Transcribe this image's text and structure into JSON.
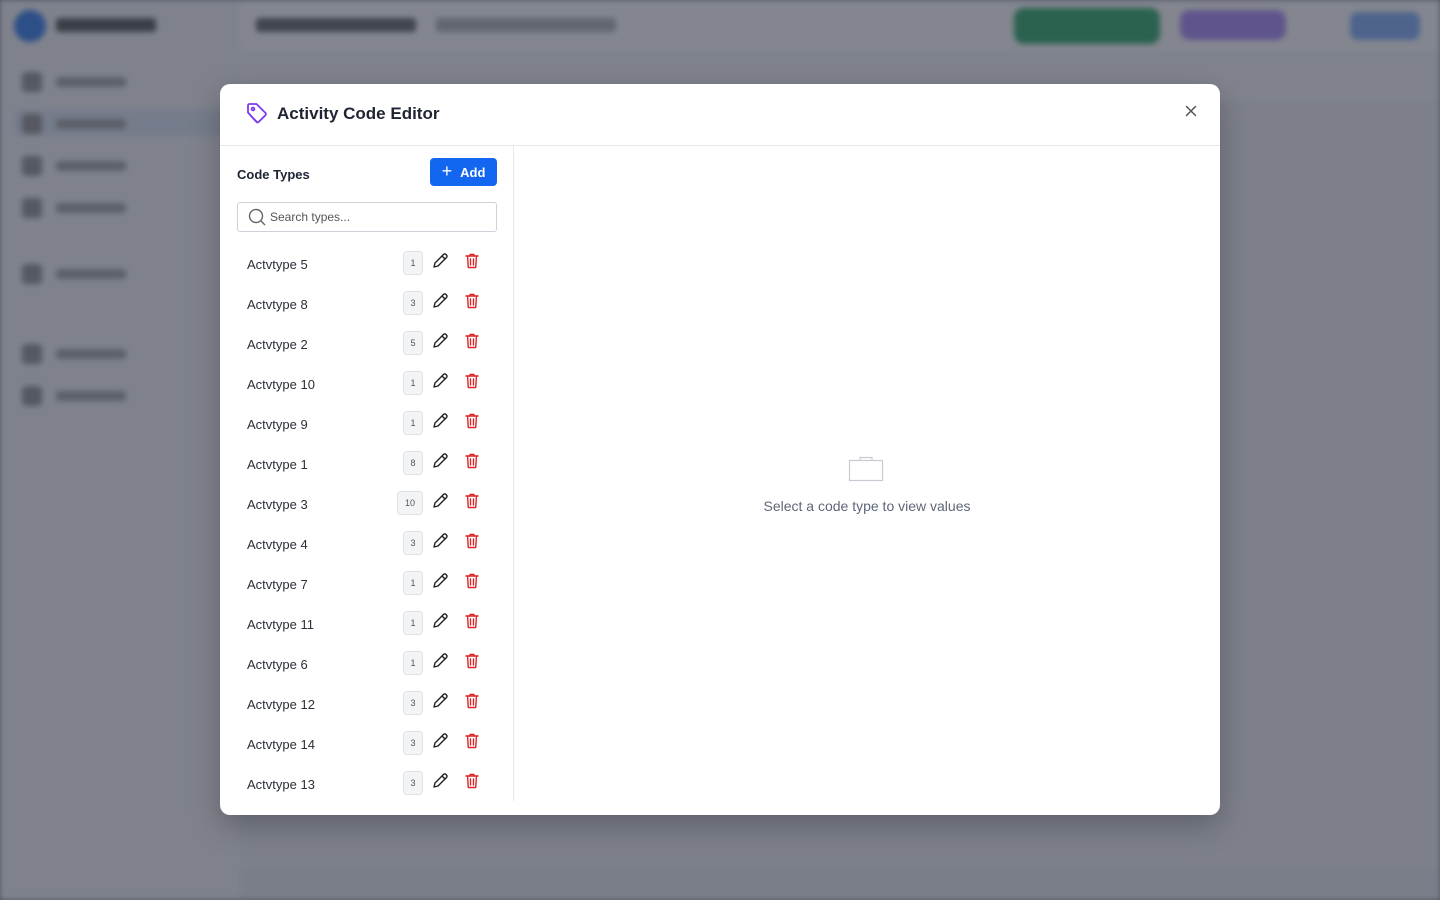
{
  "modal": {
    "title": "Activity Code Editor",
    "close_label": "×"
  },
  "left_pane": {
    "title": "Code Types",
    "add_label": "Add",
    "search_placeholder": "Search types...",
    "types": [
      {
        "name": "Actvtype 5",
        "count": "1"
      },
      {
        "name": "Actvtype 8",
        "count": "3"
      },
      {
        "name": "Actvtype 2",
        "count": "5"
      },
      {
        "name": "Actvtype 10",
        "count": "1"
      },
      {
        "name": "Actvtype 9",
        "count": "1"
      },
      {
        "name": "Actvtype 1",
        "count": "8"
      },
      {
        "name": "Actvtype 3",
        "count": "10"
      },
      {
        "name": "Actvtype 4",
        "count": "3"
      },
      {
        "name": "Actvtype 7",
        "count": "1"
      },
      {
        "name": "Actvtype 11",
        "count": "1"
      },
      {
        "name": "Actvtype 6",
        "count": "1"
      },
      {
        "name": "Actvtype 12",
        "count": "3"
      },
      {
        "name": "Actvtype 14",
        "count": "3"
      },
      {
        "name": "Actvtype 13",
        "count": "3"
      }
    ]
  },
  "right_pane": {
    "empty_message": "Select a code type to view values"
  },
  "colors": {
    "primary": "#1366f0",
    "brand_icon": "#7c3aed",
    "delete": "#dc2626",
    "backdrop": "#7b7f8a"
  },
  "icons": {
    "header": "tag-icon",
    "close": "close-icon",
    "search": "search-icon",
    "edit": "pencil-icon",
    "delete": "trash-icon",
    "empty": "folder-icon"
  }
}
